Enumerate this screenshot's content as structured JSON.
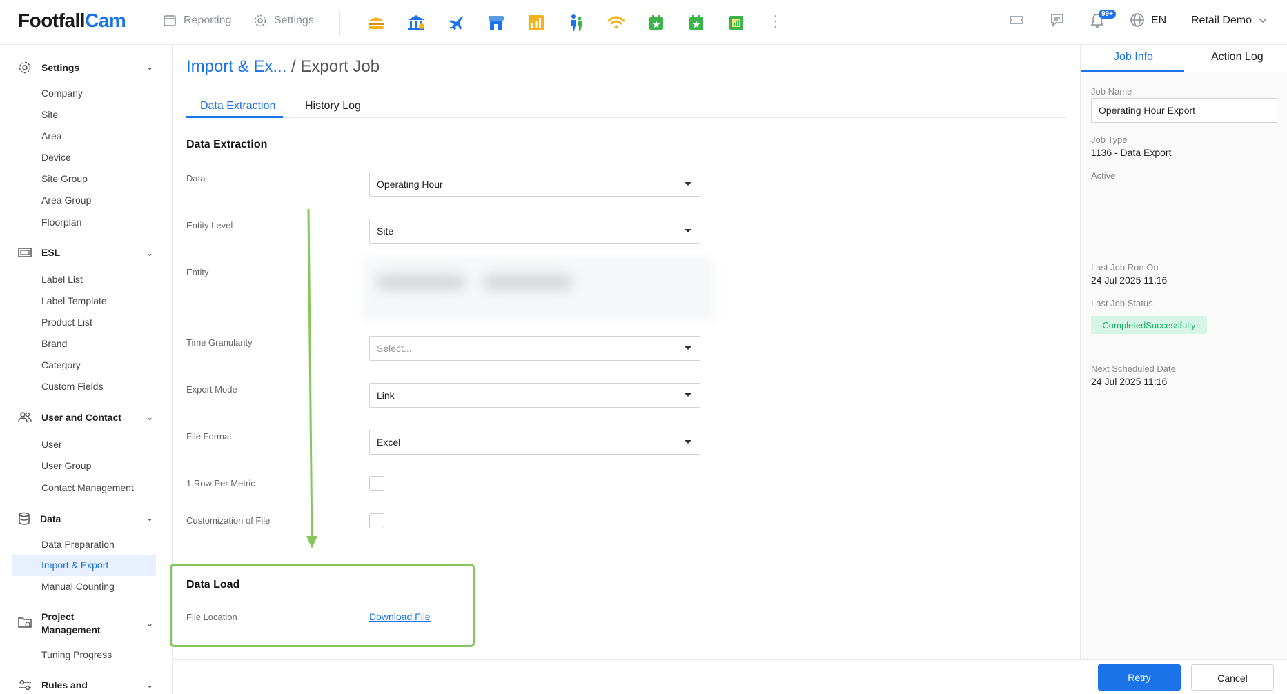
{
  "app": {
    "logo_a": "Footfall",
    "logo_b": "Cam"
  },
  "topnav": {
    "reporting": "Reporting",
    "settings": "Settings"
  },
  "apps": [
    {
      "icon": "burger-icon",
      "color": "#f5b31b"
    },
    {
      "icon": "bank-icon",
      "color": "#1a73e8"
    },
    {
      "icon": "airplane-icon",
      "color": "#1a73e8"
    },
    {
      "icon": "store-icon",
      "color": "#1a73e8"
    },
    {
      "icon": "analytics-icon",
      "color": "#f5b31b"
    },
    {
      "icon": "people-flow-icon",
      "color": "#1a73e8"
    },
    {
      "icon": "wifi-icon",
      "color": "#f5b31b"
    },
    {
      "icon": "calendar-star-icon",
      "color": "#3bb54a"
    },
    {
      "icon": "calendar-star-icon",
      "color": "#3bb54a"
    },
    {
      "icon": "report-sheet-icon",
      "color": "#3bb54a"
    }
  ],
  "header_right": {
    "notifications_badge": "99+",
    "language": "EN",
    "user": "Retail Demo"
  },
  "sidebar": {
    "settings": {
      "title": "Settings",
      "items": [
        "Company",
        "Site",
        "Area",
        "Device",
        "Site Group",
        "Area Group",
        "Floorplan"
      ]
    },
    "esl": {
      "title": "ESL",
      "items": [
        "Label List",
        "Label Template",
        "Product List",
        "Brand",
        "Category",
        "Custom Fields"
      ]
    },
    "user_contact": {
      "title": "User and Contact",
      "items": [
        "User",
        "User Group",
        "Contact Management"
      ]
    },
    "data": {
      "title": "Data",
      "items": [
        "Data Preparation",
        "Import & Export",
        "Manual Counting"
      ]
    },
    "project": {
      "title_1": "Project",
      "title_2": "Management",
      "items": [
        "Tuning Progress"
      ]
    },
    "rules": {
      "title": "Rules and"
    }
  },
  "main": {
    "crumb_link": "Import & Ex...",
    "crumb_sep": " / ",
    "crumb_current": "Export Job",
    "tabs": [
      "Data Extraction",
      "History Log"
    ],
    "section_extraction": "Data Extraction",
    "fields": {
      "data_label": "Data",
      "data_value": "Operating Hour",
      "entity_level_label": "Entity Level",
      "entity_level_value": "Site",
      "entity_label": "Entity",
      "time_gran_label": "Time Granularity",
      "time_gran_placeholder": "Select...",
      "export_mode_label": "Export Mode",
      "export_mode_value": "Link",
      "file_format_label": "File Format",
      "file_format_value": "Excel",
      "row_per_metric_label": "1 Row Per Metric",
      "customization_label": "Customization of File"
    },
    "section_load": "Data Load",
    "file_location_label": "File Location",
    "download_link": "Download File"
  },
  "right_panel": {
    "tabs": [
      "Job Info",
      "Action Log"
    ],
    "job_name_label": "Job Name",
    "job_name_value": "Operating Hour Export",
    "job_type_label": "Job Type",
    "job_type_value": "1136 - Data Export",
    "active_label": "Active",
    "last_run_label": "Last Job Run On",
    "last_run_value": "24 Jul 2025 11:16",
    "last_status_label": "Last Job Status",
    "last_status_value": "CompletedSuccessfully",
    "next_sched_label": "Next Scheduled Date",
    "next_sched_value": "24 Jul 2025 11:16"
  },
  "footer": {
    "retry": "Retry",
    "cancel": "Cancel"
  },
  "colors": {
    "accent": "#1a73e8",
    "annotation": "#86c65a",
    "success": "#1fb46c"
  }
}
